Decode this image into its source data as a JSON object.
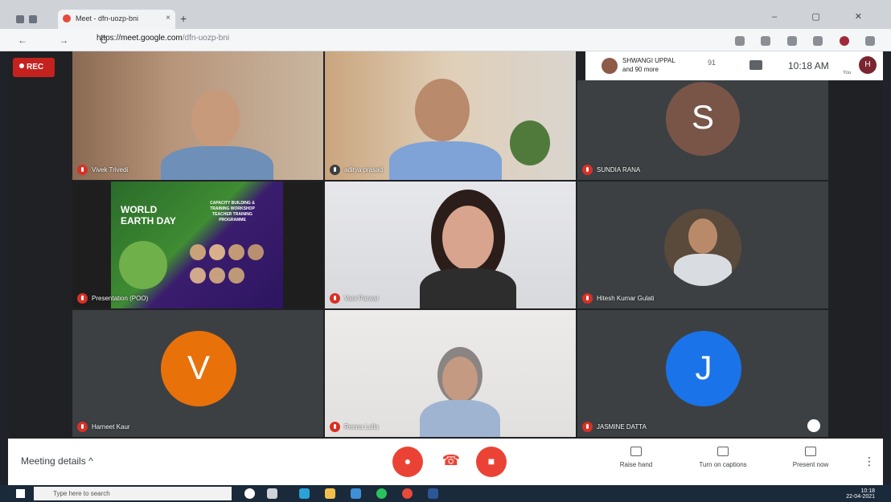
{
  "browser": {
    "tab_title": "Meet - dfn-uozp-bni",
    "tab_close": "×",
    "new_tab": "+",
    "url_scheme": "https://",
    "url_host": "meet.google.com",
    "url_path": "/dfn-uozp-bni",
    "nav_buttons": "← → C",
    "window_buttons": "– ▢ ✕"
  },
  "meet": {
    "rec_label": "REC",
    "participants_summary_line1": "SHWANGI UPPAL",
    "participants_summary_line2": "and 90 more",
    "participant_count": "91",
    "time": "10:18 AM",
    "you_label": "You",
    "tiles": [
      {
        "name": "Vivek Trivedi"
      },
      {
        "name": "aditya prasad"
      },
      {
        "name": "SUNDIA RANA",
        "initial": "S",
        "avatar_color": "#795548"
      },
      {
        "name": "Presentation (POO)"
      },
      {
        "name": "Vani Parwar"
      },
      {
        "name": "Hitesh Kumar Gulati"
      },
      {
        "name": "Harneet Kaur",
        "initial": "V",
        "avatar_color": "#e8710a"
      },
      {
        "name": "Reena Lalla"
      },
      {
        "name": "JASMINE DATTA",
        "initial": "J",
        "avatar_color": "#1a73e8"
      }
    ],
    "presentation": {
      "line1": "WORLD",
      "line2": "EARTH DAY",
      "right_line1": "CAPACITY BUILDING &",
      "right_line2": "TRAINING WORKSHOP",
      "right_line3": "TEACHER TRAINING",
      "right_line4": "PROGRAMME"
    }
  },
  "controls": {
    "meeting_details": "Meeting details",
    "chevron": "^",
    "mic_icon": "mic-off-icon",
    "end_icon": "call-end-icon",
    "cam_icon": "camera-off-icon",
    "raise_hand": "Raise hand",
    "captions": "Turn on captions",
    "present": "Present now",
    "more": "⋮"
  },
  "taskbar": {
    "search_placeholder": "Type here to search",
    "tray_time": "10:18",
    "tray_date": "22-04-2021"
  },
  "colors": {
    "end_call": "#ea4335",
    "mic_off": "#d93025",
    "rec": "#c5221f"
  }
}
